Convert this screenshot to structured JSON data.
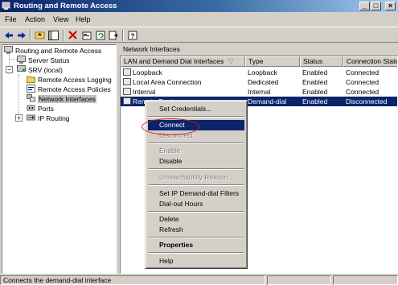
{
  "window": {
    "title": "Routing and Remote Access",
    "buttons": {
      "minimize": "_",
      "maximize": "□",
      "close": "×"
    }
  },
  "menubar": {
    "items": [
      {
        "label": "File"
      },
      {
        "label": "Action"
      },
      {
        "label": "View"
      },
      {
        "label": "Help"
      }
    ]
  },
  "toolbar": {
    "icons": [
      "back-arrow-icon",
      "forward-arrow-icon",
      "up-folder-icon",
      "show-hide-tree-icon",
      "delete-icon",
      "properties-icon",
      "refresh-icon",
      "export-list-icon",
      "help-icon"
    ]
  },
  "tree": {
    "items": [
      {
        "label": "Routing and Remote Access"
      },
      {
        "label": "Server Status"
      },
      {
        "label": "SRV (local)"
      },
      {
        "label": "Remote Access Logging"
      },
      {
        "label": "Remote Access Policies"
      },
      {
        "label": "Network Interfaces"
      },
      {
        "label": "Ports"
      },
      {
        "label": "IP Routing"
      }
    ],
    "expanders": {
      "collapse": "−",
      "expand": "+"
    }
  },
  "details": {
    "pane_title": "Network Interfaces",
    "columns": [
      "LAN and Demand Dial Interfaces",
      "Type",
      "Status",
      "Connection State"
    ],
    "rows": [
      {
        "name": "Loopback",
        "type": "Loopback",
        "status": "Enabled",
        "state": "Connected"
      },
      {
        "name": "Local Area Connection",
        "type": "Dedicated",
        "status": "Enabled",
        "state": "Connected"
      },
      {
        "name": "Internal",
        "type": "Internal",
        "status": "Enabled",
        "state": "Connected"
      },
      {
        "name": "Remote Router",
        "type": "Demand-dial",
        "status": "Enabled",
        "state": "Disconnected"
      }
    ]
  },
  "context_menu": {
    "items": [
      {
        "label": "Set Credentials..."
      },
      {
        "label": "Connect"
      },
      {
        "label": "Disconnect"
      },
      {
        "label": "Enable"
      },
      {
        "label": "Disable"
      },
      {
        "label": "Unreachability Reason..."
      },
      {
        "label": "Set IP Demand-dial Filters"
      },
      {
        "label": "Dial-out Hours"
      },
      {
        "label": "Delete"
      },
      {
        "label": "Refresh"
      },
      {
        "label": "Properties"
      },
      {
        "label": "Help"
      }
    ]
  },
  "statusbar": {
    "text": "Connects the demand-dial interface"
  },
  "colors": {
    "title_gradient_start": "#0a246a",
    "selection": "#0a246a",
    "face": "#d4d0c8",
    "annotation_ellipse": "#d02020"
  }
}
